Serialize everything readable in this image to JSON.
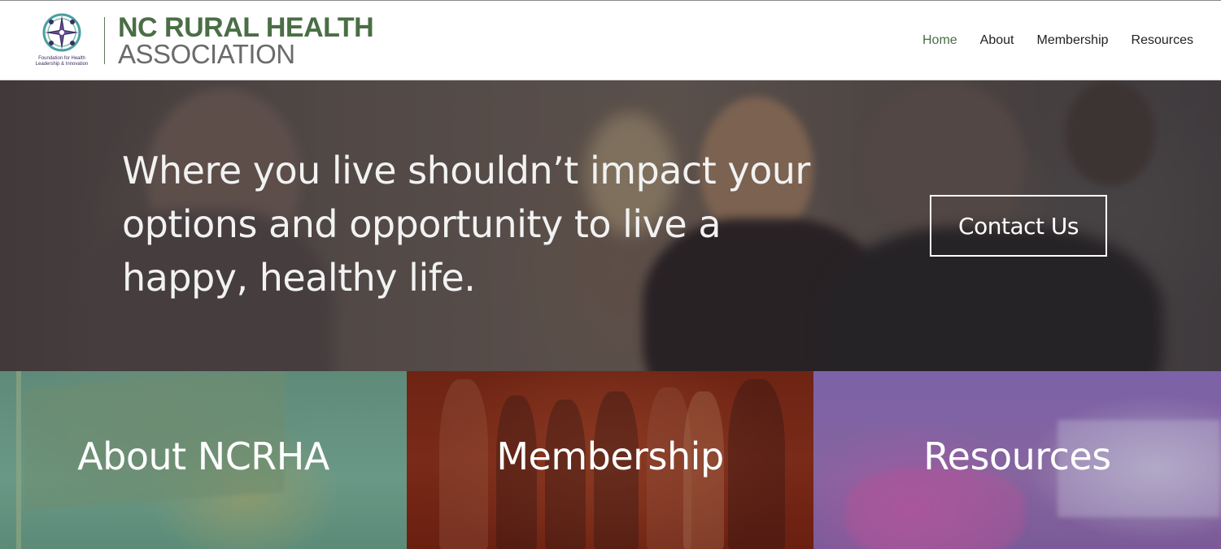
{
  "header": {
    "logo": {
      "caption_line1": "Foundation for Health",
      "caption_line2": "Leadership & Innovation",
      "title": "NC RURAL HEALTH",
      "subtitle": "ASSOCIATION"
    },
    "nav": [
      {
        "label": "Home",
        "active": true
      },
      {
        "label": "About",
        "active": false
      },
      {
        "label": "Membership",
        "active": false
      },
      {
        "label": "Resources",
        "active": false
      }
    ]
  },
  "hero": {
    "tagline_lines": [
      "Where you live shouldn’t impact your",
      "options and opportunity to live a",
      "happy, healthy life."
    ],
    "cta_label": "Contact Us"
  },
  "tiles": [
    {
      "label": "About NCRHA",
      "color": "#5e8a7a"
    },
    {
      "label": "Membership",
      "color": "#6e2414"
    },
    {
      "label": "Resources",
      "color": "#7c62a8"
    }
  ],
  "colors": {
    "brand_green": "#4a6e45",
    "logo_purple": "#3b2e60",
    "logo_teal": "#4aa0a0"
  }
}
